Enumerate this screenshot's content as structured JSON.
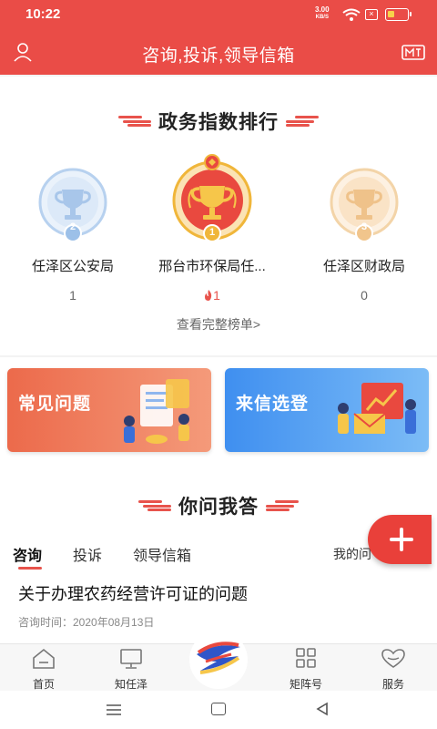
{
  "status_bar": {
    "time": "10:22",
    "net_speed": "3.00",
    "net_unit": "KB/S",
    "battery_level": 0.35
  },
  "header": {
    "title": "咨询,投诉,领导信箱"
  },
  "ranking": {
    "title": "政务指数排行",
    "items": [
      {
        "rank": "2",
        "name": "任泽区公安局",
        "score": "1",
        "hot": false
      },
      {
        "rank": "1",
        "name": "邢台市环保局任...",
        "score": "1",
        "hot": true
      },
      {
        "rank": "3",
        "name": "任泽区财政局",
        "score": "0",
        "hot": false
      }
    ],
    "more_label": "查看完整榜单>"
  },
  "features": {
    "faq_label": "常见问题",
    "letter_label": "来信选登"
  },
  "qa": {
    "title": "你问我答",
    "tabs": [
      "咨询",
      "投诉",
      "领导信箱",
      "我的问"
    ],
    "active_tab": 0,
    "item": {
      "title": "关于办理农药经营许可证的问题",
      "time": "咨询时间：2020年08月13日"
    }
  },
  "tabbar": {
    "items": [
      "首页",
      "知任泽",
      "",
      "矩阵号",
      "服务"
    ]
  },
  "colors": {
    "brand_red": "#ea4c47",
    "gold": "#f0b63a",
    "silver": "#9cc0e8",
    "bronze": "#f1c58c"
  }
}
